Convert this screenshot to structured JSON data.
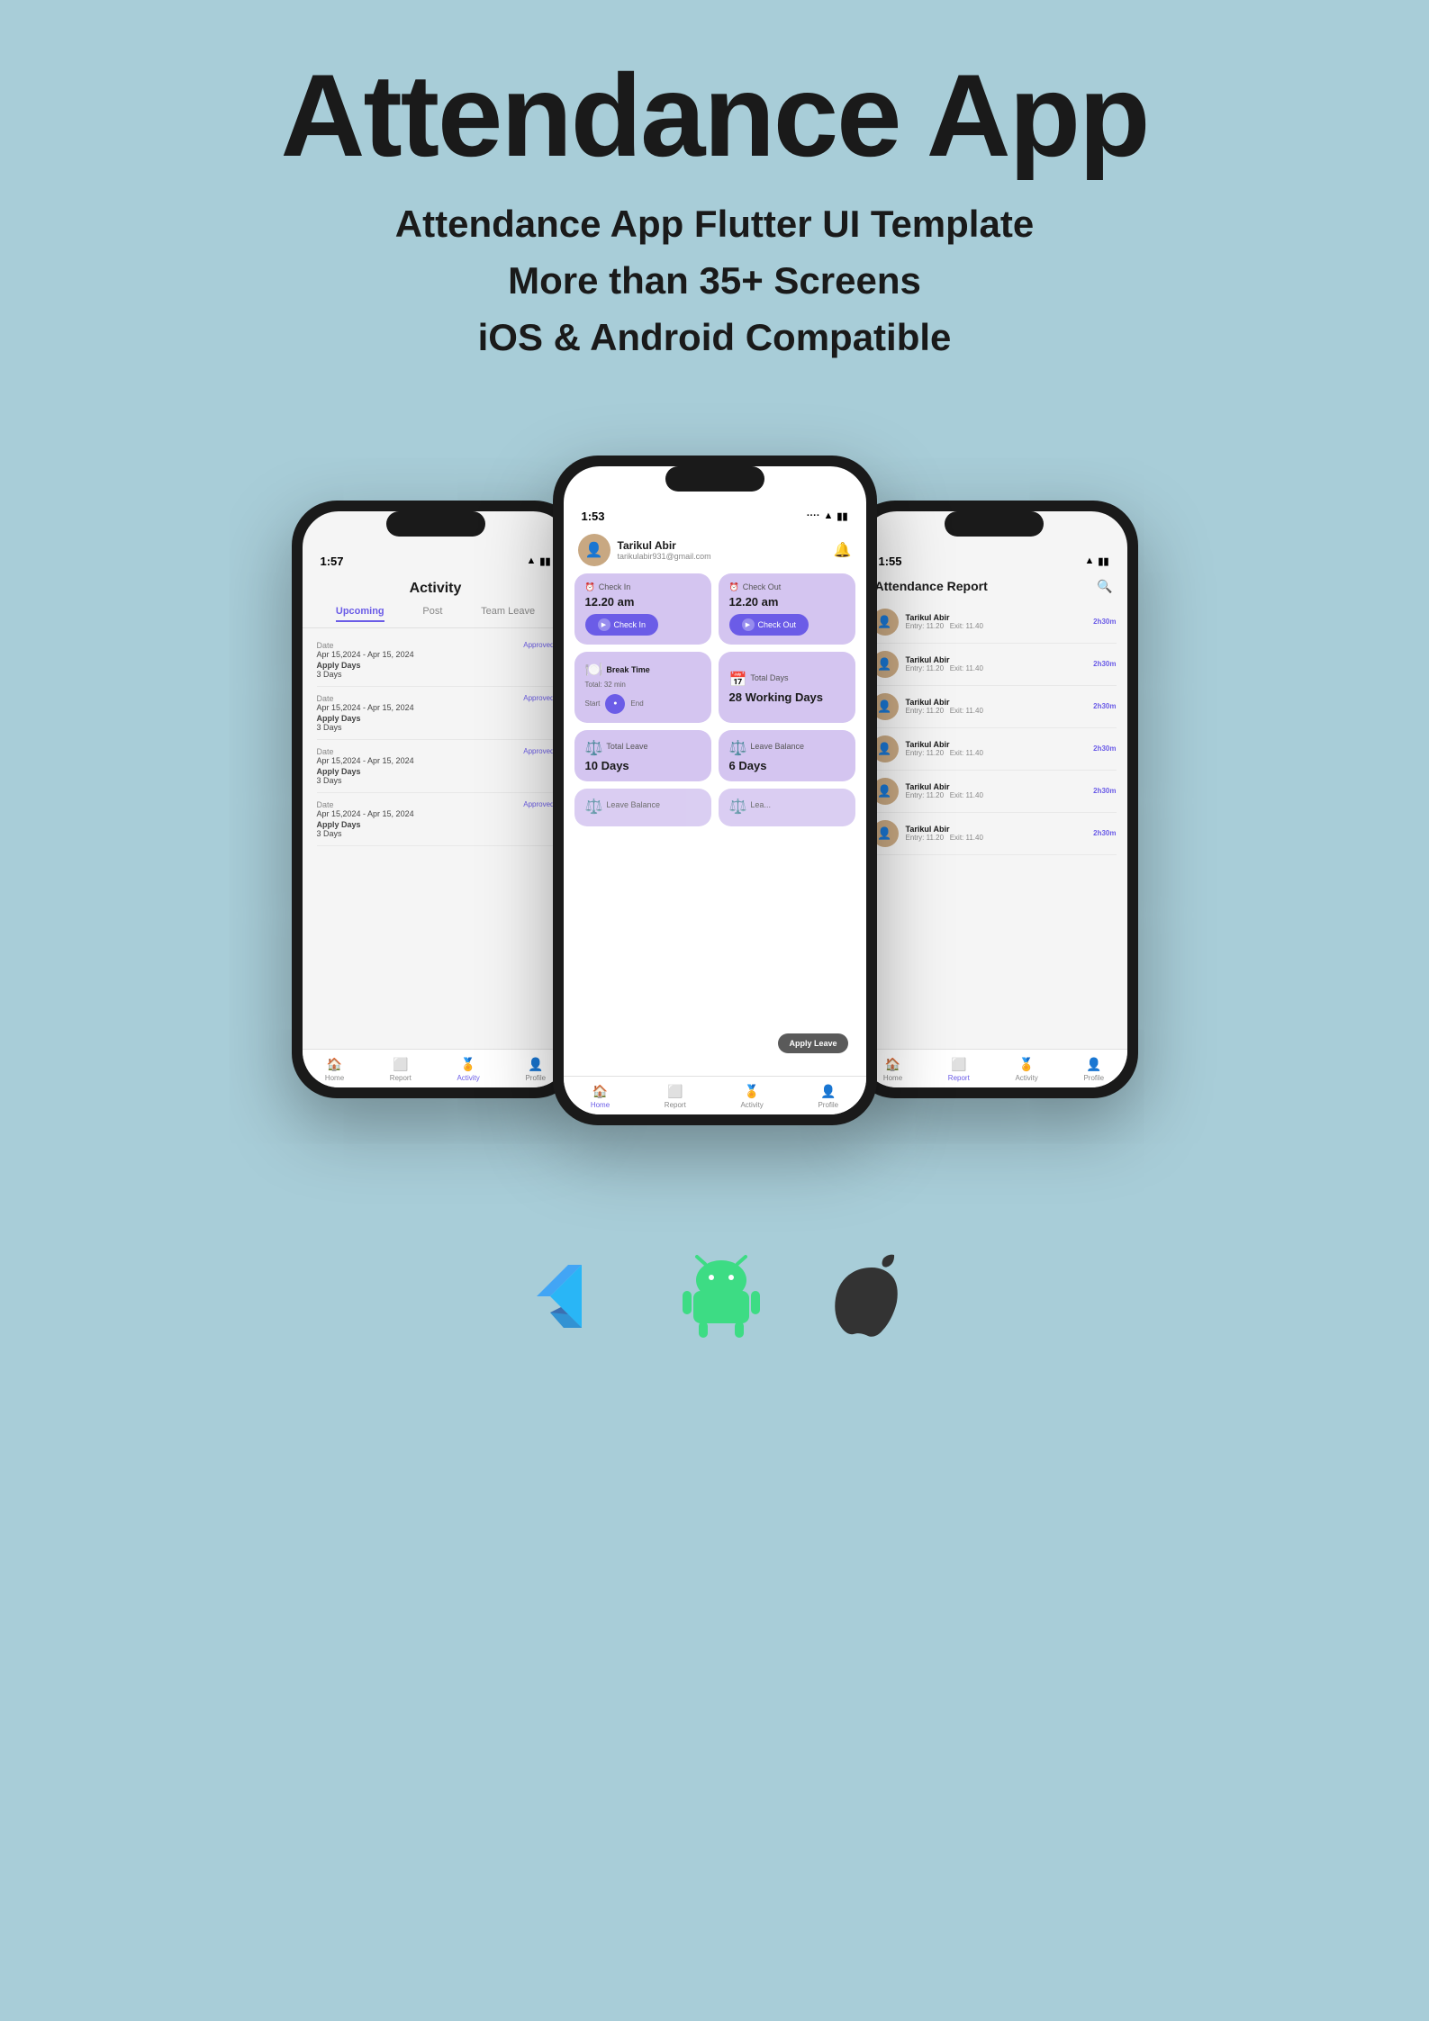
{
  "header": {
    "main_title": "Attendance App",
    "subtitle_line1": "Attendance App Flutter UI Template",
    "subtitle_line2": "More than 35+ Screens",
    "subtitle_line3": "iOS & Android Compatible"
  },
  "phone_left": {
    "time": "1:57",
    "screen_title": "Activity",
    "tabs": [
      "Upcoming",
      "Post",
      "Team Leave"
    ],
    "active_tab": "Upcoming",
    "items": [
      {
        "date_label": "Date",
        "date_value": "Apr 15,2024 - Apr 15, 2024",
        "apply_label": "Apply Days",
        "days": "3 Days",
        "status": "Approved"
      },
      {
        "date_label": "Date",
        "date_value": "Apr 15,2024 - Apr 15, 2024",
        "apply_label": "Apply Days",
        "days": "3 Days",
        "status": "Approved"
      },
      {
        "date_label": "Date",
        "date_value": "Apr 15,2024 - Apr 15, 2024",
        "apply_label": "Apply Days",
        "days": "3 Days",
        "status": "Approved"
      },
      {
        "date_label": "Date",
        "date_value": "Apr 15,2024 - Apr 15, 2024",
        "apply_label": "Apply Days",
        "days": "3 Days",
        "status": "Approved"
      }
    ],
    "nav_items": [
      {
        "label": "Home",
        "icon": "🏠",
        "active": false
      },
      {
        "label": "Report",
        "icon": "⬛",
        "active": false
      },
      {
        "label": "Activity",
        "icon": "🏅",
        "active": true
      },
      {
        "label": "Profile",
        "icon": "👤",
        "active": false
      }
    ]
  },
  "phone_center": {
    "time": "1:53",
    "user_name": "Tarikul Abir",
    "user_email": "tarikulabir931@gmail.com",
    "check_in_label": "Check In",
    "check_in_time": "12.20 am",
    "check_out_label": "Check Out",
    "check_out_time": "12.20 am",
    "check_in_btn": "Check In",
    "check_out_btn": "Check Out",
    "break_title": "Break Time",
    "break_subtitle": "Total: 32 min",
    "break_start": "Start",
    "break_end": "End",
    "total_days_label": "Total Days",
    "total_days_value": "28 Working Days",
    "total_leave_label": "Total Leave",
    "total_leave_value": "10 Days",
    "leave_balance_label": "Leave Balance",
    "leave_balance_value": "6 Days",
    "leave_balance2_label": "Leave Balance",
    "leave_label2": "Lea...",
    "apply_leave_tooltip": "Apply Leave",
    "nav_items": [
      {
        "label": "Home",
        "icon": "🏠",
        "active": true
      },
      {
        "label": "Report",
        "icon": "⬛",
        "active": false
      },
      {
        "label": "Activity",
        "icon": "🏅",
        "active": false
      },
      {
        "label": "Profile",
        "icon": "👤",
        "active": false
      }
    ]
  },
  "phone_right": {
    "time": "1:55",
    "report_title": "Attendance Report",
    "report_items": [
      {
        "name": "Tarikul Abir",
        "entry": "Entry: 11.20",
        "exit": "Exit: 11.40",
        "duration": "2h30m"
      },
      {
        "name": "Tarikul Abir",
        "entry": "Entry: 11.20",
        "exit": "Exit: 11.40",
        "duration": "2h30m"
      },
      {
        "name": "Tarikul Abir",
        "entry": "Entry: 11.20",
        "exit": "Exit: 11.40",
        "duration": "2h30m"
      },
      {
        "name": "Tarikul Abir",
        "entry": "Entry: 11.20",
        "exit": "Exit: 11.40",
        "duration": "2h30m"
      },
      {
        "name": "Tarikul Abir",
        "entry": "Entry: 11.20",
        "exit": "Exit: 11.40",
        "duration": "2h30m"
      },
      {
        "name": "Tarikul Abir",
        "entry": "Entry: 11.20",
        "exit": "Exit: 11.40",
        "duration": "2h30m"
      }
    ],
    "nav_items": [
      {
        "label": "Home",
        "icon": "🏠",
        "active": false
      },
      {
        "label": "Report",
        "icon": "⬛",
        "active": true
      },
      {
        "label": "Activity",
        "icon": "🏅",
        "active": false
      },
      {
        "label": "Profile",
        "icon": "👤",
        "active": false
      }
    ]
  },
  "footer": {
    "brand_icons": [
      "Flutter",
      "Android",
      "Apple"
    ]
  },
  "colors": {
    "background": "#a8cdd8",
    "accent_purple": "#6b5ce7",
    "card_purple": "#d4c5f0",
    "phone_dark": "#1a1a1a"
  }
}
